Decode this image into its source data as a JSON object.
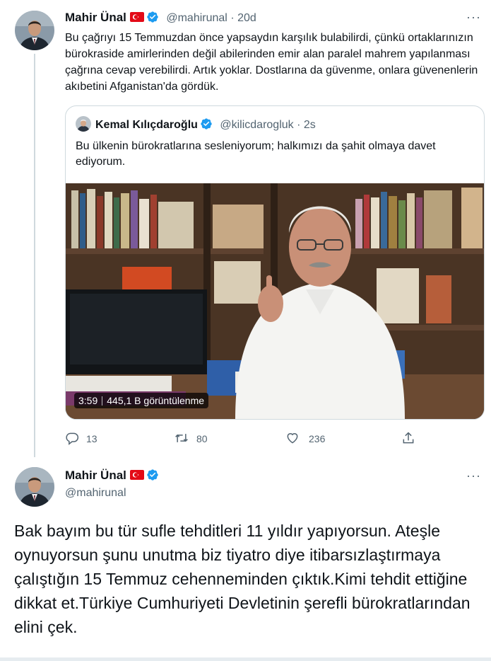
{
  "parent_tweet": {
    "author_name": "Mahir Ünal",
    "author_handle": "@mahirunal",
    "separator": "·",
    "age": "20d",
    "text": "Bu çağrıyı 15 Temmuzdan önce yapsaydın karşılık bulabilirdi, çünkü ortaklarınızın bürokraside amirlerinden değil abilerinden emir alan paralel mahrem yapılanması çağrına cevap verebilirdi. Artık yoklar. Dostlarına da güvenme, onlara güvenenlerin akıbetini Afganistan'da gördük.",
    "more_icon": "more-horizontal-icon",
    "quote": {
      "author_name": "Kemal Kılıçdaroğlu",
      "author_handle": "@kilicdarogluk",
      "separator": "·",
      "age": "2s",
      "text": "Bu ülkenin bürokratlarına sesleniyorum; halkımızı da şahit olmaya davet ediyorum.",
      "video": {
        "duration": "3:59",
        "views": "445,1 B görüntülenme"
      }
    },
    "actions": {
      "reply_count": "13",
      "retweet_count": "80",
      "like_count": "236",
      "reply_icon": "reply-icon",
      "retweet_icon": "retweet-icon",
      "like_icon": "heart-icon",
      "share_icon": "share-icon"
    }
  },
  "main_tweet": {
    "author_name": "Mahir Ünal",
    "author_handle": "@mahirunal",
    "text": "Bak bayım bu tür sufle tehditleri 11 yıldır yapıyorsun. Ateşle oynuyorsun şunu unutma biz tiyatro diye itibarsızlaştırmaya çalıştığın 15 Temmuz cehenneminden çıktık.Kimi tehdit ettiğine dikkat et.Türkiye Cumhuriyeti Devletinin şerefli bürokratlarından elini çek."
  },
  "colors": {
    "text_primary": "#0f1419",
    "text_secondary": "#536471",
    "verified_blue": "#1d9bf0",
    "flag_red": "#e30a17",
    "border": "#cfd9de"
  }
}
